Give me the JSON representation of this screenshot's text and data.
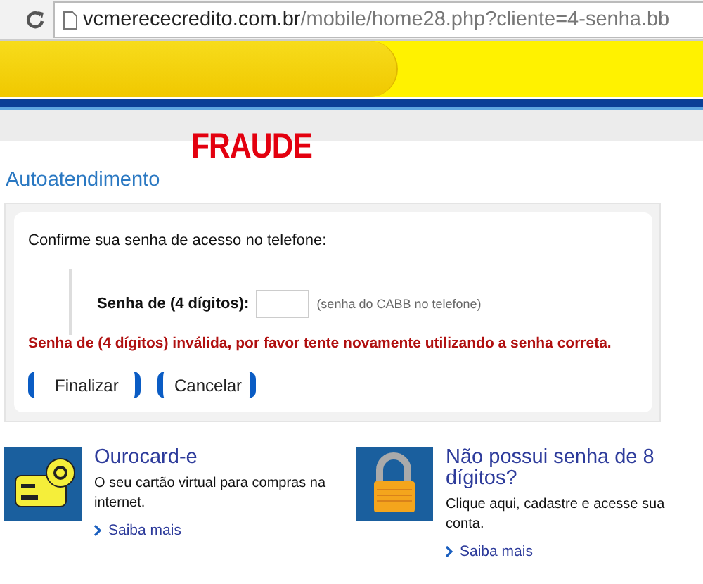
{
  "browser": {
    "url_domain": "vcmerececredito.com.br",
    "url_path": "/mobile/home28.php?cliente=4-senha.bb"
  },
  "annotation": "FRAUDE",
  "section_title": "Autoatendimento",
  "form": {
    "prompt": "Confirme sua senha de acesso no telefone:",
    "field_label": "Senha de (4 dígitos):",
    "hint": "(senha do CABB no telefone)",
    "error": "Senha de (4 dígitos) inválida, por favor tente novamente utilizando a senha correta.",
    "buttons": [
      "Finalizar",
      "Cancelar"
    ]
  },
  "promos": [
    {
      "kind": "card",
      "title": "Ourocard-e",
      "text": "O seu cartão virtual para compras na internet.",
      "link": "Saiba mais"
    },
    {
      "kind": "lock",
      "title": "Não possui senha de 8 dígitos?",
      "text": "Clique aqui, cadastre e acesse sua conta.",
      "link": "Saiba mais"
    }
  ]
}
